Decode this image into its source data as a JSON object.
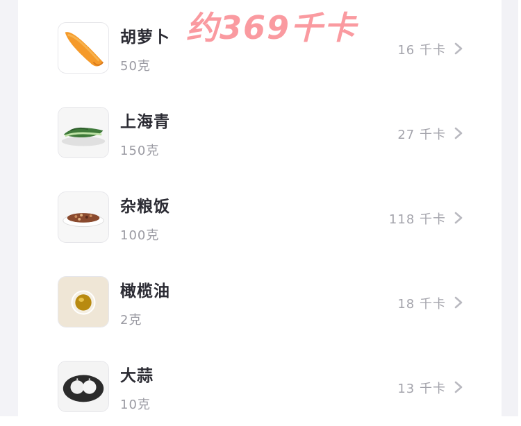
{
  "overlay": {
    "calorie_total": "约369千卡"
  },
  "colors": {
    "banner": "#fa9aa0",
    "name": "#2b2b33",
    "muted": "#9a9aa2"
  },
  "foods": [
    {
      "name": "胡萝卜",
      "amount": "50克",
      "kcal": "16 千卡",
      "image": "carrot-image"
    },
    {
      "name": "上海青",
      "amount": "150克",
      "kcal": "27 千卡",
      "image": "bok-choy-image"
    },
    {
      "name": "杂粮饭",
      "amount": "100克",
      "kcal": "118 千卡",
      "image": "mixed-grain-rice-image"
    },
    {
      "name": "橄榄油",
      "amount": "2克",
      "kcal": "18 千卡",
      "image": "olive-oil-image"
    },
    {
      "name": "大蒜",
      "amount": "10克",
      "kcal": "13 千卡",
      "image": "garlic-image"
    }
  ],
  "icons": {
    "row_arrow": "chevron-right-icon"
  }
}
